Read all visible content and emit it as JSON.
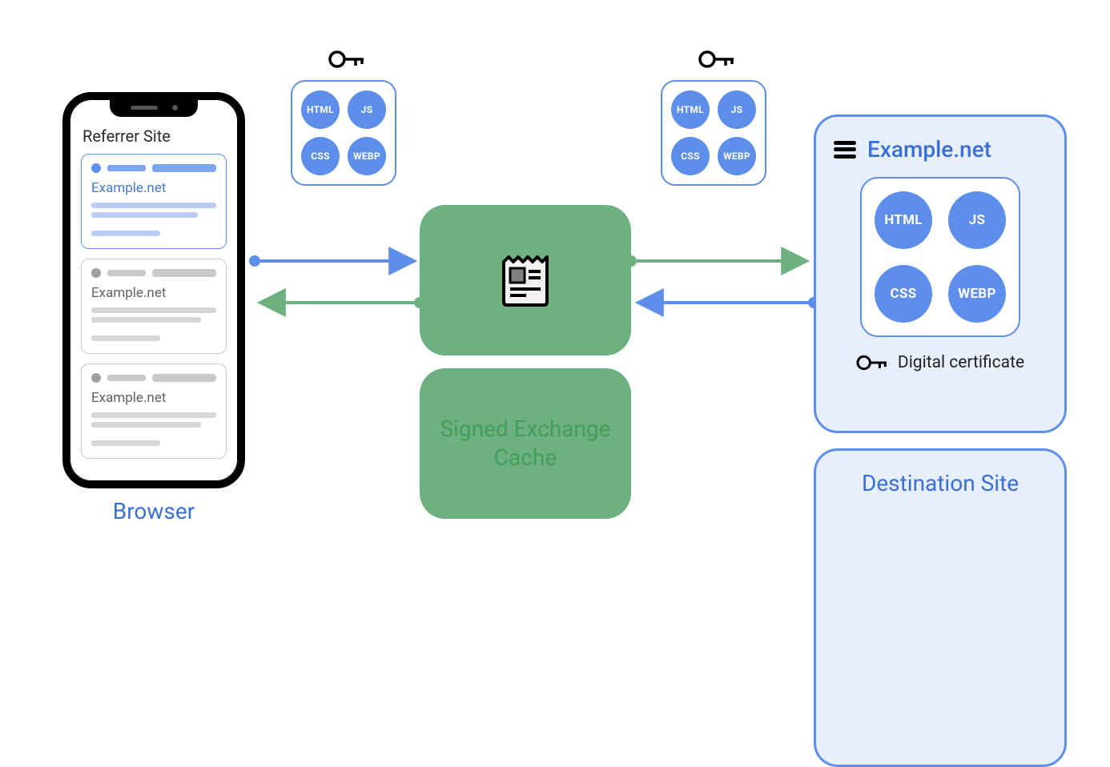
{
  "browser": {
    "label": "Browser",
    "page_title": "Referrer Site",
    "cards": [
      {
        "site": "Example.net",
        "highlighted": true
      },
      {
        "site": "Example.net",
        "highlighted": false
      },
      {
        "site": "Example.net",
        "highlighted": false
      }
    ]
  },
  "packages": {
    "chips": {
      "a": "HTML",
      "b": "JS",
      "c": "CSS",
      "d": "WEBP"
    }
  },
  "cache": {
    "label": "Signed Exchange\nCache"
  },
  "destination": {
    "label": "Destination Site",
    "title": "Example.net",
    "certificate_label": "Digital certificate"
  },
  "colors": {
    "blue": "#5d8ee9",
    "blue_text": "#3a6fd8",
    "green_box": "#6cb17f",
    "green_text": "#449d5d",
    "blue_bg": "#e7eefc"
  }
}
